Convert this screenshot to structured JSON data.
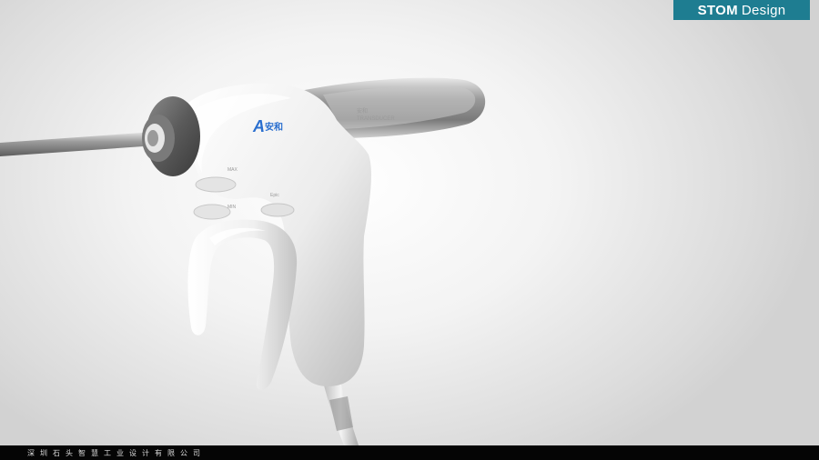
{
  "brand": {
    "bold": "STOM",
    "light": "Design",
    "color": "#1e7d91"
  },
  "device": {
    "logo_letter": "A",
    "logo_text": "安和",
    "label_top": "安和",
    "label_transducer": "TRANSDUCER",
    "button_upper_label": "MAX",
    "button_lower_label": "MIN",
    "button_side_label": "Epic"
  },
  "footer": {
    "company": "深圳石头智慧工业设计有限公司"
  }
}
